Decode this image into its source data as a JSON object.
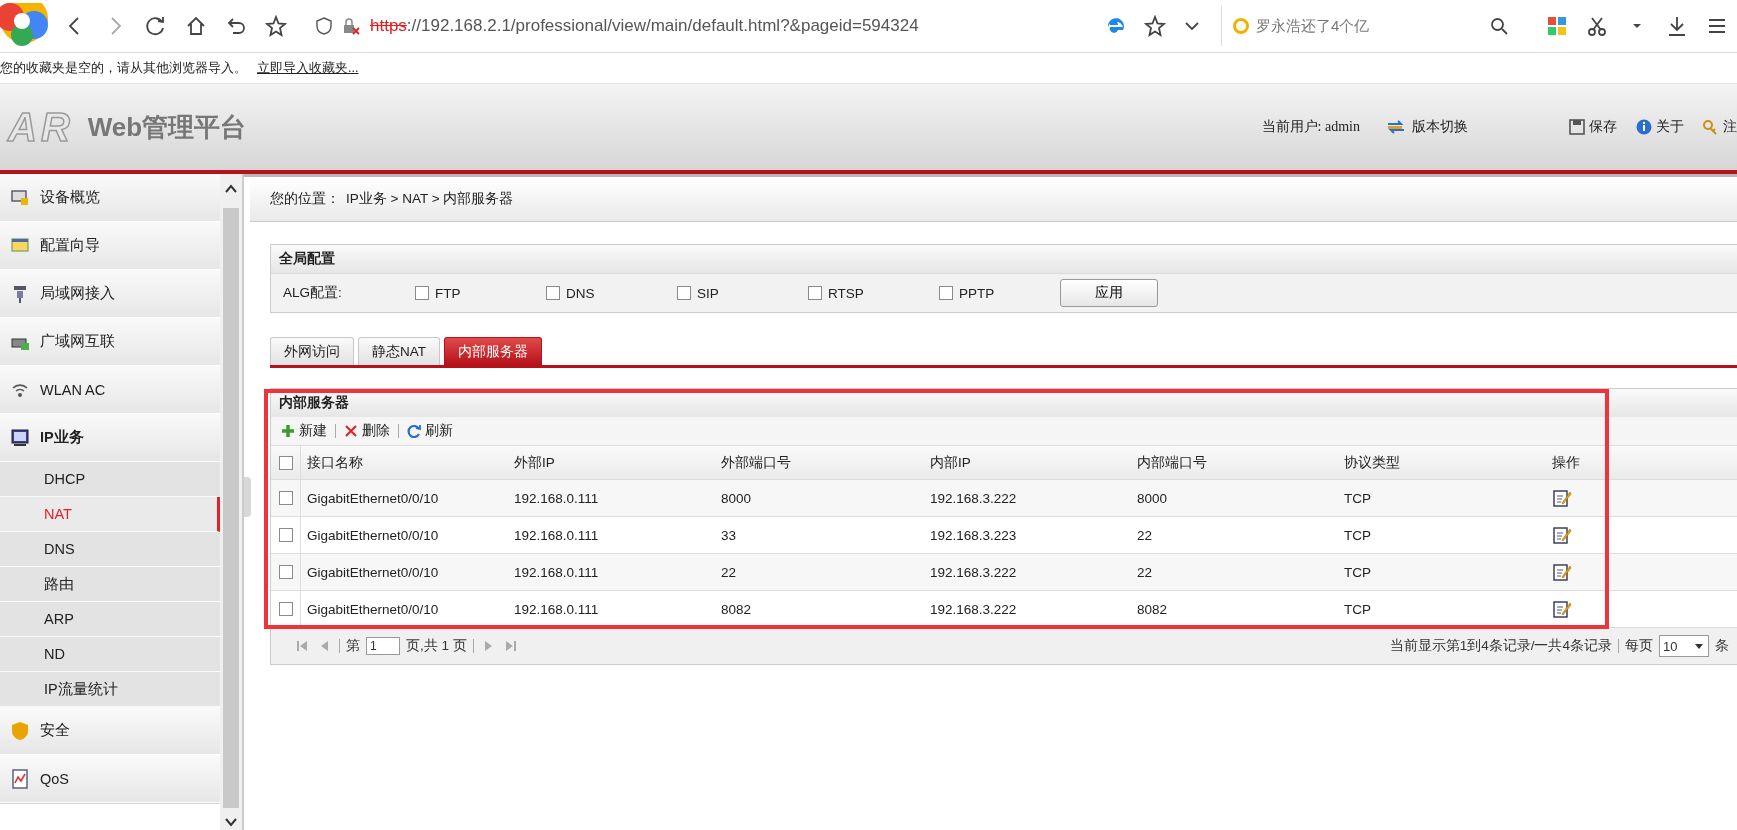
{
  "browser": {
    "url_scheme": "https",
    "url_rest": "://192.168.2.1/professional/view/main/default.html?&pageid=594324",
    "search": "罗永浩还了4个亿"
  },
  "bookmarks_bar": {
    "message": "您的收藏夹是空的，请从其他浏览器导入。",
    "link": "立即导入收藏夹..."
  },
  "header": {
    "logo": "AR",
    "title": "Web管理平台",
    "user_label": "当前用户:",
    "user": "admin",
    "actions": [
      {
        "kind": "switch",
        "label": "版本切换"
      },
      {
        "kind": "save",
        "label": "保存"
      },
      {
        "kind": "about",
        "label": "关于"
      },
      {
        "kind": "logout",
        "label": "注"
      }
    ]
  },
  "sidebar": {
    "items": [
      {
        "kind": "overview",
        "label": "设备概览",
        "expanded": false
      },
      {
        "kind": "wizard",
        "label": "配置向导",
        "expanded": false
      },
      {
        "kind": "lan",
        "label": "局域网接入",
        "expanded": false
      },
      {
        "kind": "wan",
        "label": "广域网互联",
        "expanded": false
      },
      {
        "kind": "wlan",
        "label": "WLAN AC",
        "expanded": false
      },
      {
        "kind": "ip",
        "label": "IP业务",
        "expanded": true,
        "children": [
          {
            "label": "DHCP",
            "selected": false
          },
          {
            "label": "NAT",
            "selected": true
          },
          {
            "label": "DNS",
            "selected": false
          },
          {
            "label": "路由",
            "selected": false
          },
          {
            "label": "ARP",
            "selected": false
          },
          {
            "label": "ND",
            "selected": false
          },
          {
            "label": "IP流量统计",
            "selected": false
          }
        ]
      },
      {
        "kind": "security",
        "label": "安全",
        "expanded": false
      },
      {
        "kind": "qos",
        "label": "QoS",
        "expanded": false
      }
    ]
  },
  "breadcrumb": {
    "label": "您的位置：",
    "path": "IP业务 > NAT > 内部服务器"
  },
  "global_config": {
    "title": "全局配置",
    "alg_label": "ALG配置:",
    "options": [
      {
        "label": "FTP",
        "checked": false
      },
      {
        "label": "DNS",
        "checked": false
      },
      {
        "label": "SIP",
        "checked": false
      },
      {
        "label": "RTSP",
        "checked": false
      },
      {
        "label": "PPTP",
        "checked": false
      }
    ],
    "apply_button": "应用"
  },
  "tabs": [
    {
      "label": "外网访问",
      "selected": false
    },
    {
      "label": "静态NAT",
      "selected": false
    },
    {
      "label": "内部服务器",
      "selected": true
    }
  ],
  "panel": {
    "title": "内部服务器",
    "toolbar": [
      {
        "kind": "add",
        "label": "新建"
      },
      {
        "kind": "delete",
        "label": "删除"
      },
      {
        "kind": "refresh",
        "label": "刷新"
      }
    ],
    "table": {
      "select_all_checked": false,
      "columns": [
        "接口名称",
        "外部IP",
        "外部端口号",
        "内部IP",
        "内部端口号",
        "协议类型",
        "操作"
      ],
      "rows": [
        {
          "checked": false,
          "cells": [
            "GigabitEthernet0/0/10",
            "192.168.0.111",
            "8000",
            "192.168.3.222",
            "8000",
            "TCP"
          ]
        },
        {
          "checked": false,
          "cells": [
            "GigabitEthernet0/0/10",
            "192.168.0.111",
            "33",
            "192.168.3.223",
            "22",
            "TCP"
          ]
        },
        {
          "checked": false,
          "cells": [
            "GigabitEthernet0/0/10",
            "192.168.0.111",
            "22",
            "192.168.3.222",
            "22",
            "TCP"
          ]
        },
        {
          "checked": false,
          "cells": [
            "GigabitEthernet0/0/10",
            "192.168.0.111",
            "8082",
            "192.168.3.222",
            "8082",
            "TCP"
          ]
        }
      ]
    },
    "pagination": {
      "page_prefix": "第",
      "page": "1",
      "page_suffix": "页,共 1 页",
      "summary": "当前显示第1到4条记录/一共4条记录",
      "per_page_label": "每页",
      "per_page": "10",
      "per_page_unit": "条"
    }
  }
}
